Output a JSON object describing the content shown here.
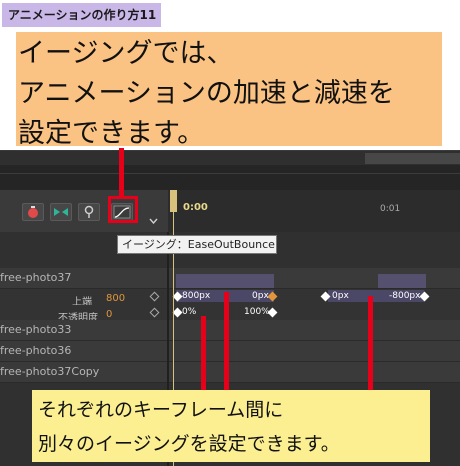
{
  "tutorial": {
    "tag": "アニメーションの作り方11",
    "headline_lines": [
      "イージングでは、",
      "アニメーションの加速と減速を",
      "設定できます。"
    ],
    "footnote_lines": [
      "それぞれのキーフレーム間に",
      "別々のイージングを設定できます。"
    ]
  },
  "toolbar": {
    "buttons": [
      {
        "name": "record-button",
        "icon": "record-icon"
      },
      {
        "name": "keyframe-nav-button",
        "icon": "keyframe-nav-icon"
      },
      {
        "name": "pin-button",
        "icon": "pin-icon"
      },
      {
        "name": "easing-button",
        "icon": "easing-curve-icon"
      }
    ],
    "dropdown_icon": "chevron-down-icon"
  },
  "timeline": {
    "current_time": "0:00",
    "ruler_mark": "0:01",
    "tooltip": "イージング：EaseOutBounce"
  },
  "layers": [
    {
      "name": "free-photo37"
    },
    {
      "name": "free-photo33"
    },
    {
      "name": "free-photo36"
    },
    {
      "name": "free-photo37Copy"
    }
  ],
  "properties": [
    {
      "label": "上端",
      "value": "800",
      "keyframes": [
        "800px",
        "0px",
        "0px",
        "-800px"
      ]
    },
    {
      "label": "不透明度",
      "value": "0",
      "keyframes": [
        "0%",
        "100%"
      ]
    }
  ],
  "colors": {
    "accent_marker": "#e6001a",
    "headline_bg": "#fbc383",
    "footnote_bg": "#fbef92",
    "tag_bg": "#c9b7e8",
    "keyframe_value": "#e0963a"
  }
}
